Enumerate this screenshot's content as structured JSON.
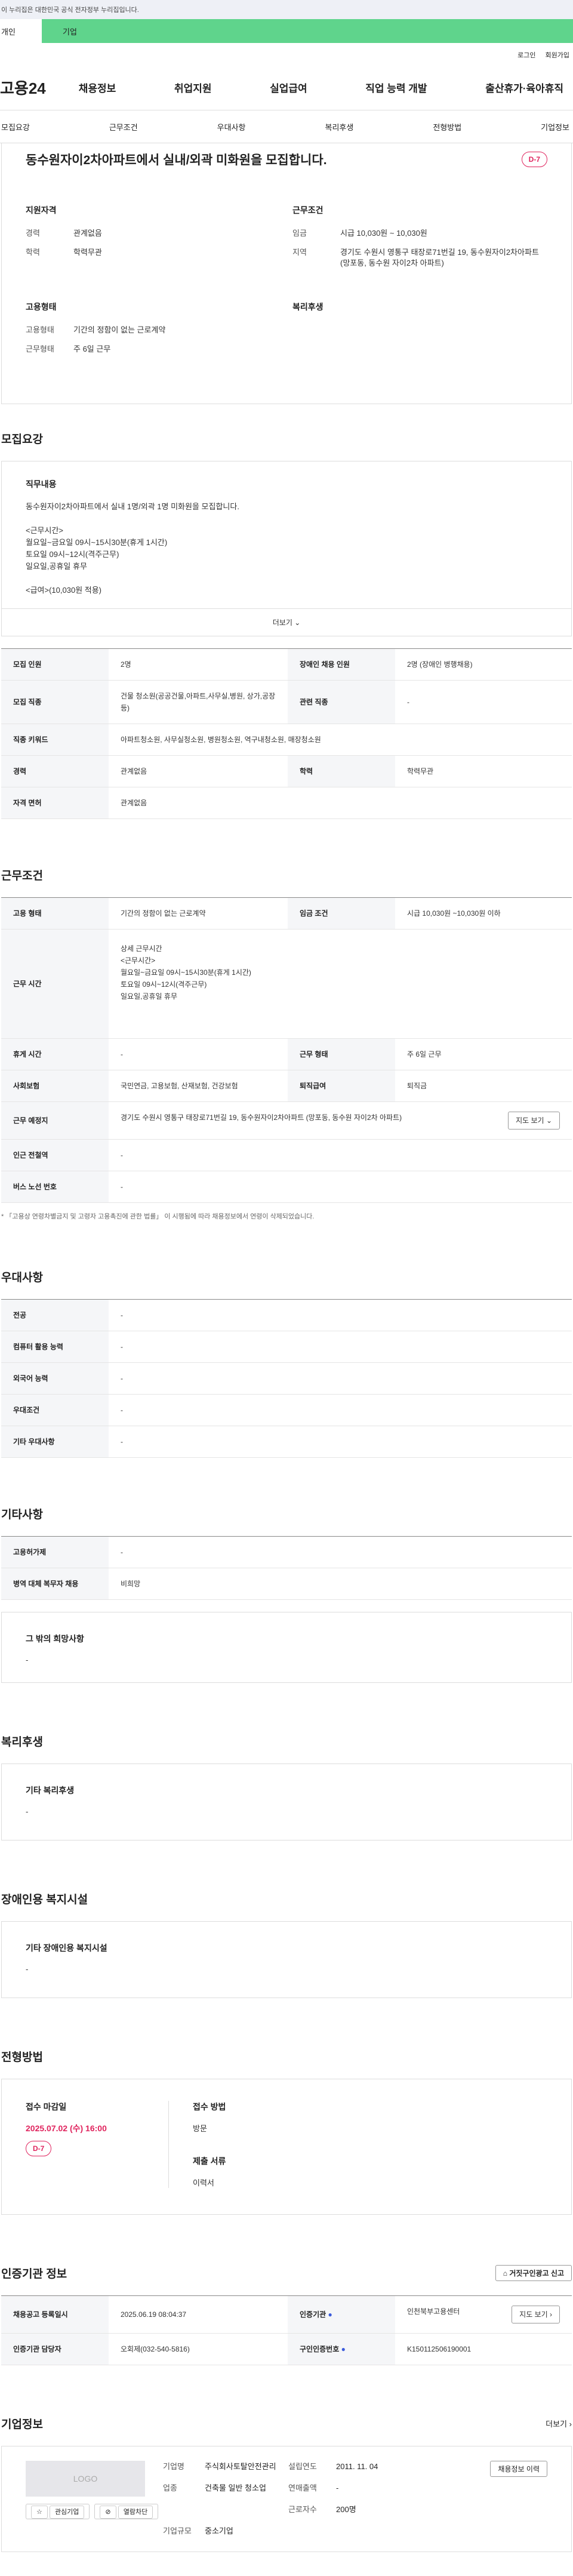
{
  "gov_banner": "이 누리집은 대한민국 공식 전자정부 누리집입니다.",
  "user_tabs": [
    "개인",
    "기업"
  ],
  "util_links": [
    "로그인",
    "회원가입"
  ],
  "logo": "고용24",
  "gnb": [
    "채용정보",
    "취업지원",
    "실업급여",
    "직업 능력 개발",
    "출산휴가·육아휴직"
  ],
  "anchor_tabs": [
    "모집요강",
    "근무조건",
    "우대사항",
    "복리후생",
    "전형방법",
    "기업정보"
  ],
  "job": {
    "title": "동수원자이2차아파트에서 실내/외곽 미화원을 모집합니다.",
    "dday": "D-7"
  },
  "summary": {
    "qual": {
      "title": "지원자격",
      "rows": [
        {
          "k": "경력",
          "v": "관계없음"
        },
        {
          "k": "학력",
          "v": "학력무관"
        }
      ]
    },
    "cond": {
      "title": "근무조건",
      "rows": [
        {
          "k": "임금",
          "v": "시급 10,030원 ~ 10,030원"
        },
        {
          "k": "지역",
          "v": "경기도 수원시 영통구 태장로71번길 19, 동수원자이2차아파트 (망포동, 동수원 자이2차 아파트)"
        }
      ]
    },
    "emp": {
      "title": "고용형태",
      "rows": [
        {
          "k": "고용형태",
          "v": "기간의 정함이 없는 근로계약"
        },
        {
          "k": "근무형태",
          "v": "주 6일 근무"
        }
      ]
    },
    "welfare": {
      "title": "복리후생"
    }
  },
  "recruit": {
    "section_title": "모집요강",
    "duty_title": "직무내용",
    "duty_text": "동수원자이2차아파트에서 실내 1명/외곽 1명 미화원을 모집합니다.\n\n<근무시간>\n월요일~금요일 09시~15시30분(휴게 1시간)\n토요일 09시~12시(격주근무)\n일요일,공휴일 휴무\n\n<급여>(10,030원 적용)",
    "more_label": "더보기",
    "table": {
      "headcount_k": "모집 인원",
      "headcount_v": "2명",
      "disabled_k": "장애인 채용 인원",
      "disabled_v": "2명 (장애인 병행채용)",
      "job_k": "모집 직종",
      "job_v": "건물 청소원(공공건물,아파트,사무실,병원, 상가,공장 등)",
      "related_k": "관련 직종",
      "related_v": "-",
      "kw_k": "직종 키워드",
      "kw_v": "아파트청소원, 사무실청소원, 병원청소원, 역구내청소원, 매장청소원",
      "career_k": "경력",
      "career_v": "관계없음",
      "edu_k": "학력",
      "edu_v": "학력무관",
      "license_k": "자격 면허",
      "license_v": "관계없음"
    }
  },
  "work": {
    "section_title": "근무조건",
    "type_k": "고용 형태",
    "type_v": "기간의 정함이 없는 근로계약",
    "wage_k": "임금 조건",
    "wage_v": "시급 10,030원 ~10,030원 이하",
    "hours_k": "근무 시간",
    "hours_v": "상세 근무시간\n<근무시간>\n월요일~금요일 09시~15시30분(휴게 1시간)\n토요일 09시~12시(격주근무)\n일요일,공휴일 휴무",
    "break_k": "휴게 시간",
    "break_v": "-",
    "form_k": "근무 형태",
    "form_v": "주 6일 근무",
    "ins_k": "사회보험",
    "ins_v": "국민연금, 고용보험, 산재보험, 건강보험",
    "ret_k": "퇴직급여",
    "ret_v": "퇴직금",
    "place_k": "근무 예정지",
    "place_v": "경기도 수원시 영통구 태장로71번길 19, 동수원자이2차아파트 (망포동, 동수원 자이2차 아파트)",
    "map_btn": "지도 보기",
    "subway_k": "인근 전철역",
    "subway_v": "-",
    "bus_k": "버스 노선 번호",
    "bus_v": "-",
    "note": "* 「고용상 연령차별금지 및 고령자 고용촉진에 관한 법률」 이 시행됨에 따라 채용정보에서 연령이 삭제되었습니다."
  },
  "pref": {
    "section_title": "우대사항",
    "rows": [
      {
        "k": "전공",
        "v": "-"
      },
      {
        "k": "컴퓨터 활용 능력",
        "v": "-"
      },
      {
        "k": "외국어 능력",
        "v": "-"
      },
      {
        "k": "우대조건",
        "v": "-"
      },
      {
        "k": "기타 우대사항",
        "v": "-"
      }
    ]
  },
  "etc": {
    "section_title": "기타사항",
    "rows": [
      {
        "k": "고용허가제",
        "v": "-"
      },
      {
        "k": "병역 대체 복무자 채용",
        "v": "비희망"
      }
    ],
    "other_title": "그 밖의 희망사항",
    "other_v": "-"
  },
  "welfare": {
    "section_title": "복리후생",
    "box_title": "기타 복리후생",
    "box_v": "-"
  },
  "facility": {
    "section_title": "장애인용 복지시설",
    "box_title": "기타 장애인용 복지시설",
    "box_v": "-"
  },
  "apply": {
    "section_title": "전형방법",
    "deadline_label": "접수 마감일",
    "deadline": "2025.07.02 (수) 16:00",
    "dday": "D-7",
    "method_label": "접수 방법",
    "method": "방문",
    "docs_label": "제출 서류",
    "docs": "이력서"
  },
  "cert": {
    "section_title": "인증기관 정보",
    "report_btn": "거짓구인광고 신고",
    "reg_k": "채용공고 등록일시",
    "reg_v": "2025.06.19 08:04:37",
    "org_k": "인증기관",
    "org_v": "인천북부고용센터",
    "map_btn": "지도 보기",
    "mgr_k": "인증기관 담당자",
    "mgr_v": "오회제(032-540-5816)",
    "no_k": "구인인증번호",
    "no_v": "K150112506190001"
  },
  "company": {
    "section_title": "기업정보",
    "more": "더보기",
    "logo_text": "LOGO",
    "fav_btn": "관심기업",
    "block_btn": "열람차단",
    "name_k": "기업명",
    "name_v": "주식회사토탈안전관리",
    "found_k": "설립연도",
    "found_v": "2011. 11. 04",
    "ind_k": "업종",
    "ind_v": "건축물 일반 청소업",
    "sales_k": "연매출액",
    "sales_v": "-",
    "emp_k": "근로자수",
    "emp_v": "200명",
    "size_k": "기업규모",
    "size_v": "중소기업",
    "history_btn": "채용정보 이력"
  }
}
